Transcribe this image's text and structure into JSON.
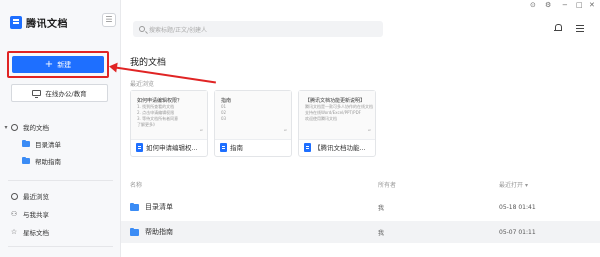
{
  "app": {
    "name": "腾讯文档"
  },
  "sidebar": {
    "new_label": "新建",
    "online_label": "在线办公/教育",
    "my_docs": "我的文档",
    "folders": [
      "目录清单",
      "帮助指南"
    ],
    "items": [
      {
        "label": "最近浏览",
        "icon": "clock-icon"
      },
      {
        "label": "与我共享",
        "icon": "user-icon"
      },
      {
        "label": "星标文档",
        "icon": "star-icon"
      }
    ]
  },
  "header": {
    "search_placeholder": "搜索标题/正文/创建人"
  },
  "main": {
    "title": "我的文档",
    "recent_label": "最近浏览",
    "cards": [
      {
        "preview_title": "如何申请编辑权限？",
        "preview_lines": [
          "1. 找到所查看的文档",
          "2. 点击申请编辑权限",
          "3. 等待文档所有者同意",
          "了解更多》"
        ],
        "name": "如何申请编辑权..."
      },
      {
        "preview_title": "指南",
        "preview_lines": [
          "01",
          "02",
          "03"
        ],
        "name": "指南"
      },
      {
        "preview_title": "【腾讯文档功能更新说明】",
        "preview_lines": [
          "腾讯文档是一款可多人协作的在线文档",
          "支持在线Word/Excel/PPT/PDF",
          "欢迎使用腾讯文档"
        ],
        "name": "【腾讯文档功能..."
      }
    ],
    "columns": {
      "name": "名称",
      "owner": "所有者",
      "time": "最近打开"
    },
    "rows": [
      {
        "name": "目录清单",
        "owner": "我",
        "time": "05-18 01:41"
      },
      {
        "name": "帮助指南",
        "owner": "我",
        "time": "05-07 01:11"
      }
    ]
  },
  "colors": {
    "accent": "#1e6fff",
    "highlight": "#e02424",
    "folder": "#3b8cf5"
  }
}
